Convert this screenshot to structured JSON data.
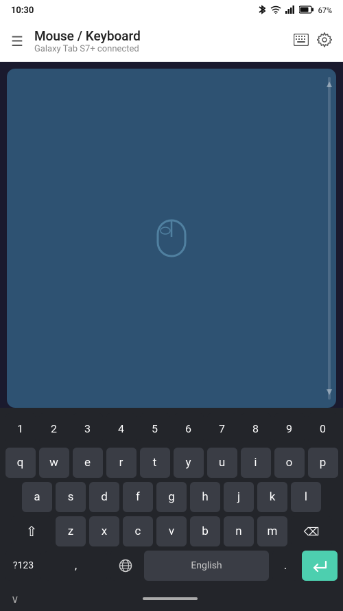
{
  "statusBar": {
    "time": "10:30",
    "icons": [
      "bluetooth",
      "wifi",
      "signal",
      "battery"
    ],
    "batteryText": "67%"
  },
  "appBar": {
    "title": "Mouse / Keyboard",
    "subtitle": "Galaxy Tab S7+ connected",
    "hamburgerLabel": "☰",
    "keyboardIconLabel": "⌨",
    "settingsIconLabel": "⚙"
  },
  "trackpad": {
    "mouseIconAlt": "mouse icon"
  },
  "keyboard": {
    "numberRow": [
      "1",
      "2",
      "3",
      "4",
      "5",
      "6",
      "7",
      "8",
      "9",
      "0"
    ],
    "row1": [
      "q",
      "w",
      "e",
      "r",
      "t",
      "y",
      "u",
      "i",
      "o",
      "p"
    ],
    "row2": [
      "a",
      "s",
      "d",
      "f",
      "g",
      "h",
      "j",
      "k",
      "l"
    ],
    "row3": [
      "z",
      "x",
      "c",
      "v",
      "b",
      "n",
      "m"
    ],
    "shiftLabel": "⇧",
    "backspaceLabel": "⌫",
    "numbers123Label": "?123",
    "commaLabel": ",",
    "globeLabel": "🌐",
    "spaceLabel": "English",
    "periodLabel": ".",
    "enterLabel": "↵",
    "chevronLabel": "∨"
  }
}
